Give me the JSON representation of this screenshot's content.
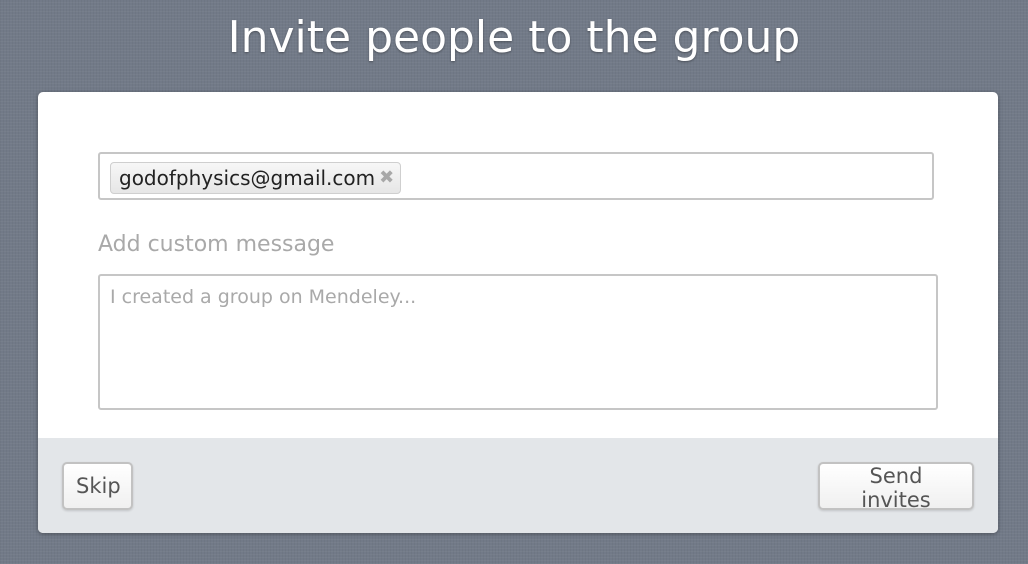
{
  "header": {
    "title": "Invite people to the group"
  },
  "recipients": {
    "tokens": [
      {
        "label": "godofphysics@gmail.com",
        "remove_glyph": "✖"
      }
    ]
  },
  "message": {
    "label": "Add custom message",
    "placeholder": "I created a group on Mendeley...",
    "value": ""
  },
  "footer": {
    "skip_label": "Skip",
    "send_label": "Send invites"
  }
}
